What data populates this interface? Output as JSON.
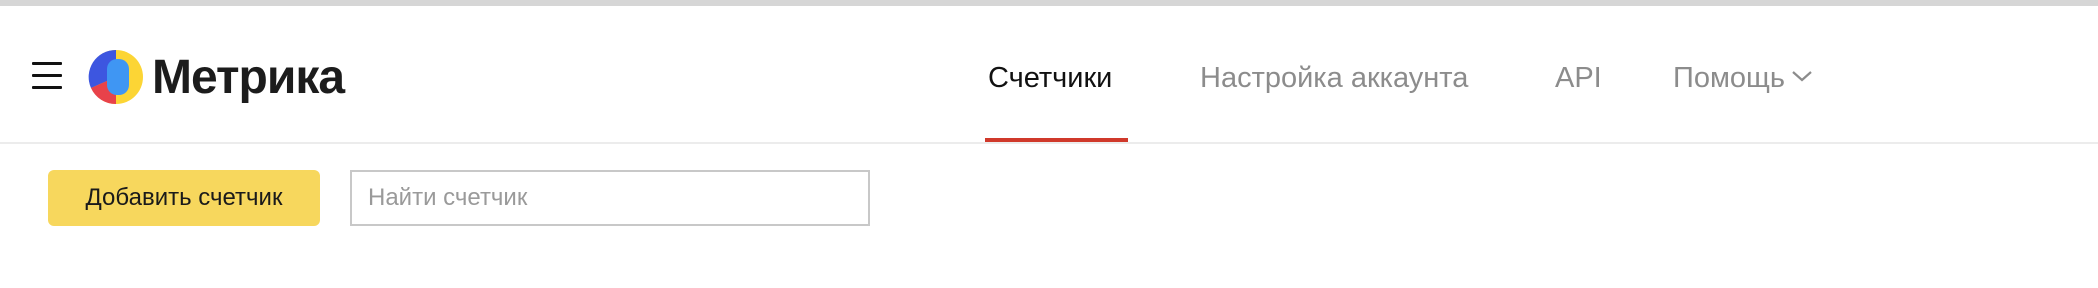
{
  "app": {
    "logo_text": "Метрика"
  },
  "nav": {
    "items": [
      {
        "label": "Счетчики",
        "active": true
      },
      {
        "label": "Настройка аккаунта",
        "active": false
      },
      {
        "label": "API",
        "active": false
      },
      {
        "label": "Помощь",
        "active": false,
        "has_dropdown": true
      }
    ],
    "active_color": "#d0392b"
  },
  "toolbar": {
    "add_button_label": "Добавить счетчик",
    "add_button_color": "#f7d75d",
    "search_placeholder": "Найти счетчик",
    "search_value": ""
  },
  "icons": {
    "menu": "hamburger-menu-icon",
    "logo": "metrika-logo-icon",
    "dropdown": "chevron-down-icon"
  }
}
